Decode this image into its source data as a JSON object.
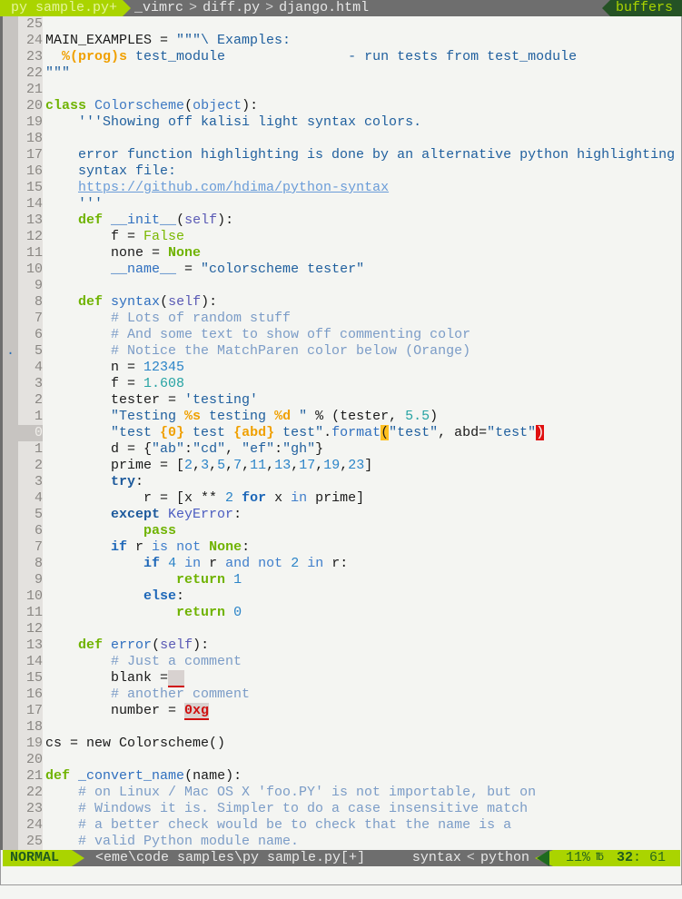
{
  "tabline": {
    "active_tab": "py sample.py+",
    "tabs": [
      "_vimrc",
      "diff.py",
      "django.html"
    ],
    "separator": ">",
    "buffers_label": "buffers"
  },
  "editor": {
    "current_line_index": 25,
    "sign_marker": ".",
    "lines": [
      {
        "num": "25",
        "tokens": []
      },
      {
        "num": "24",
        "tokens": [
          {
            "c": "plain",
            "t": "MAIN_EXAMPLES = "
          },
          {
            "c": "str",
            "t": "\"\"\"\\ Examples:"
          }
        ]
      },
      {
        "num": "23",
        "tokens": [
          {
            "c": "str",
            "t": "  "
          },
          {
            "c": "fmt",
            "t": "%(prog)s"
          },
          {
            "c": "str",
            "t": " test_module               - run tests from test_module"
          }
        ]
      },
      {
        "num": "22",
        "tokens": [
          {
            "c": "str",
            "t": "\"\"\""
          }
        ]
      },
      {
        "num": "21",
        "tokens": []
      },
      {
        "num": "20",
        "tokens": [
          {
            "c": "kw",
            "t": "class"
          },
          {
            "c": "plain",
            "t": " "
          },
          {
            "c": "cls",
            "t": "Colorscheme"
          },
          {
            "c": "plain",
            "t": "("
          },
          {
            "c": "cls",
            "t": "object"
          },
          {
            "c": "plain",
            "t": "):"
          }
        ]
      },
      {
        "num": "19",
        "tokens": [
          {
            "c": "str",
            "t": "    '''Showing off kalisi light syntax colors."
          }
        ]
      },
      {
        "num": "18",
        "tokens": []
      },
      {
        "num": "17",
        "tokens": [
          {
            "c": "str",
            "t": "    error function highlighting is done by an alternative python highlighting"
          }
        ]
      },
      {
        "num": "16",
        "tokens": [
          {
            "c": "str",
            "t": "    syntax file:"
          }
        ]
      },
      {
        "num": "15",
        "tokens": [
          {
            "c": "str",
            "t": "    "
          },
          {
            "c": "url",
            "t": "https://github.com/hdima/python-syntax"
          }
        ]
      },
      {
        "num": "14",
        "tokens": [
          {
            "c": "str",
            "t": "    '''"
          }
        ]
      },
      {
        "num": "13",
        "tokens": [
          {
            "c": "plain",
            "t": "    "
          },
          {
            "c": "kw",
            "t": "def"
          },
          {
            "c": "plain",
            "t": " "
          },
          {
            "c": "func",
            "t": "__init__"
          },
          {
            "c": "plain",
            "t": "("
          },
          {
            "c": "self",
            "t": "self"
          },
          {
            "c": "plain",
            "t": "):"
          }
        ]
      },
      {
        "num": "12",
        "tokens": [
          {
            "c": "plain",
            "t": "        f = "
          },
          {
            "c": "bool",
            "t": "False"
          }
        ]
      },
      {
        "num": "11",
        "tokens": [
          {
            "c": "plain",
            "t": "        none = "
          },
          {
            "c": "none",
            "t": "None"
          }
        ]
      },
      {
        "num": "10",
        "tokens": [
          {
            "c": "plain",
            "t": "        "
          },
          {
            "c": "func",
            "t": "__name__"
          },
          {
            "c": "plain",
            "t": " = "
          },
          {
            "c": "str",
            "t": "\"colorscheme tester\""
          }
        ]
      },
      {
        "num": "9",
        "tokens": []
      },
      {
        "num": "8",
        "tokens": [
          {
            "c": "plain",
            "t": "    "
          },
          {
            "c": "kw",
            "t": "def"
          },
          {
            "c": "plain",
            "t": " "
          },
          {
            "c": "func",
            "t": "syntax"
          },
          {
            "c": "plain",
            "t": "("
          },
          {
            "c": "self",
            "t": "self"
          },
          {
            "c": "plain",
            "t": "):"
          }
        ]
      },
      {
        "num": "7",
        "tokens": [
          {
            "c": "cmt",
            "t": "        # Lots of random stuff"
          }
        ]
      },
      {
        "num": "6",
        "tokens": [
          {
            "c": "cmt",
            "t": "        # And some text to show off commenting color"
          }
        ]
      },
      {
        "num": "5",
        "sign": true,
        "tokens": [
          {
            "c": "cmt",
            "t": "        # Notice the MatchParen color below (Orange)"
          }
        ]
      },
      {
        "num": "4",
        "tokens": [
          {
            "c": "plain",
            "t": "        n = "
          },
          {
            "c": "num",
            "t": "12345"
          }
        ]
      },
      {
        "num": "3",
        "tokens": [
          {
            "c": "plain",
            "t": "        f = "
          },
          {
            "c": "float",
            "t": "1.608"
          }
        ]
      },
      {
        "num": "2",
        "tokens": [
          {
            "c": "plain",
            "t": "        tester = "
          },
          {
            "c": "str",
            "t": "'testing'"
          }
        ]
      },
      {
        "num": "1",
        "tokens": [
          {
            "c": "plain",
            "t": "        "
          },
          {
            "c": "str",
            "t": "\"Testing "
          },
          {
            "c": "fmt",
            "t": "%s"
          },
          {
            "c": "str",
            "t": " testing "
          },
          {
            "c": "fmt",
            "t": "%d"
          },
          {
            "c": "str",
            "t": " \""
          },
          {
            "c": "plain",
            "t": " % (tester, "
          },
          {
            "c": "float",
            "t": "5.5"
          },
          {
            "c": "plain",
            "t": ")"
          }
        ]
      },
      {
        "num": "0",
        "current": true,
        "tokens": [
          {
            "c": "plain",
            "t": "        "
          },
          {
            "c": "str",
            "t": "\"test "
          },
          {
            "c": "fmt",
            "t": "{0}"
          },
          {
            "c": "str",
            "t": " test "
          },
          {
            "c": "fmt",
            "t": "{abd}"
          },
          {
            "c": "str",
            "t": " test\""
          },
          {
            "c": "plain",
            "t": "."
          },
          {
            "c": "func",
            "t": "format"
          },
          {
            "c": "match",
            "t": "("
          },
          {
            "c": "str",
            "t": "\"test\""
          },
          {
            "c": "plain",
            "t": ", abd="
          },
          {
            "c": "str",
            "t": "\"test\""
          },
          {
            "c": "cursor",
            "t": ")"
          }
        ]
      },
      {
        "num": "1",
        "tokens": [
          {
            "c": "plain",
            "t": "        d = {"
          },
          {
            "c": "str",
            "t": "\"ab\""
          },
          {
            "c": "plain",
            "t": ":"
          },
          {
            "c": "str",
            "t": "\"cd\""
          },
          {
            "c": "plain",
            "t": ", "
          },
          {
            "c": "str",
            "t": "\"ef\""
          },
          {
            "c": "plain",
            "t": ":"
          },
          {
            "c": "str",
            "t": "\"gh\""
          },
          {
            "c": "plain",
            "t": "}"
          }
        ]
      },
      {
        "num": "2",
        "tokens": [
          {
            "c": "plain",
            "t": "        prime = ["
          },
          {
            "c": "num",
            "t": "2"
          },
          {
            "c": "plain",
            "t": ","
          },
          {
            "c": "num",
            "t": "3"
          },
          {
            "c": "plain",
            "t": ","
          },
          {
            "c": "num",
            "t": "5"
          },
          {
            "c": "plain",
            "t": ","
          },
          {
            "c": "num",
            "t": "7"
          },
          {
            "c": "plain",
            "t": ","
          },
          {
            "c": "num",
            "t": "11"
          },
          {
            "c": "plain",
            "t": ","
          },
          {
            "c": "num",
            "t": "13"
          },
          {
            "c": "plain",
            "t": ","
          },
          {
            "c": "num",
            "t": "17"
          },
          {
            "c": "plain",
            "t": ","
          },
          {
            "c": "num",
            "t": "19"
          },
          {
            "c": "plain",
            "t": ","
          },
          {
            "c": "num",
            "t": "23"
          },
          {
            "c": "plain",
            "t": "]"
          }
        ]
      },
      {
        "num": "3",
        "tokens": [
          {
            "c": "plain",
            "t": "        "
          },
          {
            "c": "kw3",
            "t": "try"
          },
          {
            "c": "plain",
            "t": ":"
          }
        ]
      },
      {
        "num": "4",
        "tokens": [
          {
            "c": "plain",
            "t": "            r = [x ** "
          },
          {
            "c": "num",
            "t": "2"
          },
          {
            "c": "plain",
            "t": " "
          },
          {
            "c": "kw2",
            "t": "for"
          },
          {
            "c": "plain",
            "t": " x "
          },
          {
            "c": "op",
            "t": "in"
          },
          {
            "c": "plain",
            "t": " prime]"
          }
        ]
      },
      {
        "num": "5",
        "tokens": [
          {
            "c": "plain",
            "t": "        "
          },
          {
            "c": "kw3",
            "t": "except"
          },
          {
            "c": "plain",
            "t": " "
          },
          {
            "c": "exc",
            "t": "KeyError"
          },
          {
            "c": "plain",
            "t": ":"
          }
        ]
      },
      {
        "num": "6",
        "tokens": [
          {
            "c": "plain",
            "t": "            "
          },
          {
            "c": "kw",
            "t": "pass"
          }
        ]
      },
      {
        "num": "7",
        "tokens": [
          {
            "c": "plain",
            "t": "        "
          },
          {
            "c": "kw2",
            "t": "if"
          },
          {
            "c": "plain",
            "t": " r "
          },
          {
            "c": "op",
            "t": "is"
          },
          {
            "c": "plain",
            "t": " "
          },
          {
            "c": "op",
            "t": "not"
          },
          {
            "c": "plain",
            "t": " "
          },
          {
            "c": "none",
            "t": "None"
          },
          {
            "c": "plain",
            "t": ":"
          }
        ]
      },
      {
        "num": "8",
        "tokens": [
          {
            "c": "plain",
            "t": "            "
          },
          {
            "c": "kw2",
            "t": "if"
          },
          {
            "c": "plain",
            "t": " "
          },
          {
            "c": "num",
            "t": "4"
          },
          {
            "c": "plain",
            "t": " "
          },
          {
            "c": "op",
            "t": "in"
          },
          {
            "c": "plain",
            "t": " r "
          },
          {
            "c": "op",
            "t": "and"
          },
          {
            "c": "plain",
            "t": " "
          },
          {
            "c": "op",
            "t": "not"
          },
          {
            "c": "plain",
            "t": " "
          },
          {
            "c": "num",
            "t": "2"
          },
          {
            "c": "plain",
            "t": " "
          },
          {
            "c": "op",
            "t": "in"
          },
          {
            "c": "plain",
            "t": " r:"
          }
        ]
      },
      {
        "num": "9",
        "tokens": [
          {
            "c": "plain",
            "t": "                "
          },
          {
            "c": "kw",
            "t": "return"
          },
          {
            "c": "plain",
            "t": " "
          },
          {
            "c": "num",
            "t": "1"
          }
        ]
      },
      {
        "num": "10",
        "tokens": [
          {
            "c": "plain",
            "t": "            "
          },
          {
            "c": "kw2",
            "t": "else"
          },
          {
            "c": "plain",
            "t": ":"
          }
        ]
      },
      {
        "num": "11",
        "tokens": [
          {
            "c": "plain",
            "t": "                "
          },
          {
            "c": "kw",
            "t": "return"
          },
          {
            "c": "plain",
            "t": " "
          },
          {
            "c": "num",
            "t": "0"
          }
        ]
      },
      {
        "num": "12",
        "tokens": []
      },
      {
        "num": "13",
        "tokens": [
          {
            "c": "plain",
            "t": "    "
          },
          {
            "c": "kw",
            "t": "def"
          },
          {
            "c": "plain",
            "t": " "
          },
          {
            "c": "func",
            "t": "error"
          },
          {
            "c": "plain",
            "t": "("
          },
          {
            "c": "self",
            "t": "self"
          },
          {
            "c": "plain",
            "t": "):"
          }
        ]
      },
      {
        "num": "14",
        "tokens": [
          {
            "c": "cmt",
            "t": "        # Just a comment"
          }
        ]
      },
      {
        "num": "15",
        "tokens": [
          {
            "c": "plain",
            "t": "        blank ="
          },
          {
            "c": "blank-err",
            "t": "  "
          }
        ]
      },
      {
        "num": "16",
        "tokens": [
          {
            "c": "cmt",
            "t": "        # another comment"
          }
        ]
      },
      {
        "num": "17",
        "tokens": [
          {
            "c": "plain",
            "t": "        number = "
          },
          {
            "c": "err",
            "t": "0xg"
          }
        ]
      },
      {
        "num": "18",
        "tokens": []
      },
      {
        "num": "19",
        "tokens": [
          {
            "c": "plain",
            "t": "cs = new Colorscheme()"
          }
        ]
      },
      {
        "num": "20",
        "tokens": []
      },
      {
        "num": "21",
        "tokens": [
          {
            "c": "kw",
            "t": "def"
          },
          {
            "c": "plain",
            "t": " "
          },
          {
            "c": "func",
            "t": "_convert_name"
          },
          {
            "c": "plain",
            "t": "(name):"
          }
        ]
      },
      {
        "num": "22",
        "tokens": [
          {
            "c": "cmt",
            "t": "    # on Linux / Mac OS X 'foo.PY' is not importable, but on"
          }
        ]
      },
      {
        "num": "23",
        "tokens": [
          {
            "c": "cmt",
            "t": "    # Windows it is. Simpler to do a case insensitive match"
          }
        ]
      },
      {
        "num": "24",
        "tokens": [
          {
            "c": "cmt",
            "t": "    # a better check would be to check that the name is a"
          }
        ]
      },
      {
        "num": "25",
        "tokens": [
          {
            "c": "cmt",
            "t": "    # valid Python module name."
          }
        ]
      }
    ]
  },
  "statusline": {
    "mode": "NORMAL",
    "filepath": "<eme\\code samples\\py sample.py[+]",
    "syntax_label": "syntax",
    "separator": "<",
    "filetype": "python",
    "percent": "11%",
    "line_icon": "℔",
    "line": "32",
    "col": ": 61"
  },
  "colors": {
    "accent": "#aad400",
    "dark_green": "#255225",
    "bar_gray": "#6e6e6e",
    "background": "#f4f5f2",
    "match_paren": "#ffc020",
    "cursor": "#e01010"
  }
}
